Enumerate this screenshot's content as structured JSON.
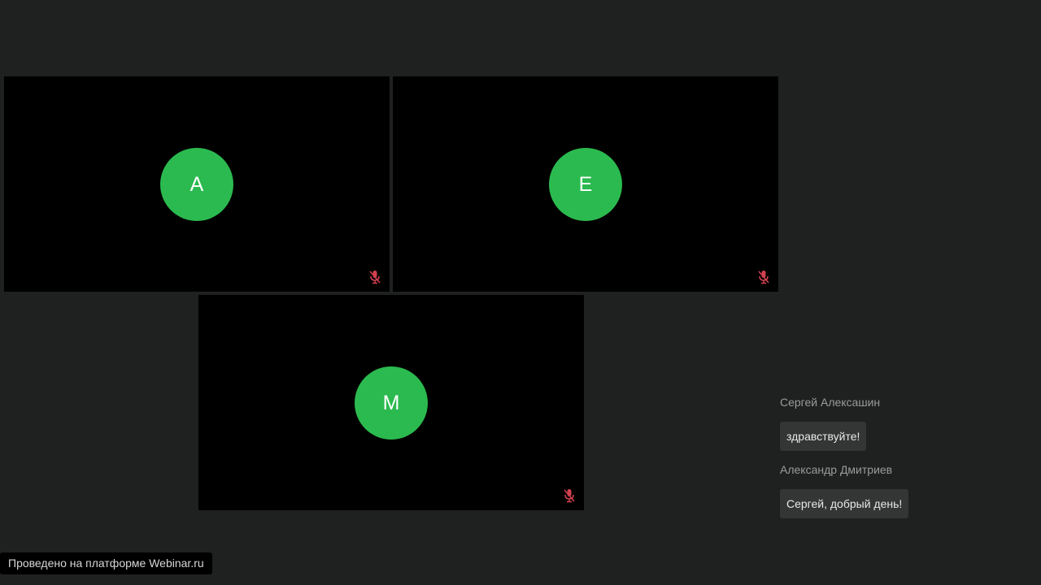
{
  "participants": [
    {
      "initial": "А",
      "mic": "muted-mic-icon"
    },
    {
      "initial": "Е",
      "mic": "muted-mic-icon"
    },
    {
      "initial": "М",
      "mic": "muted-mic-icon"
    }
  ],
  "chat": {
    "messages": [
      {
        "author": "Сергей Алексашин",
        "text": "здравствуйте!"
      },
      {
        "author": "Александр Дмитриев",
        "text": "Сергей, добрый день!"
      }
    ]
  },
  "footer": {
    "platform_text": "Проведено на платформе Webinar.ru"
  },
  "colors": {
    "background": "#1f2020",
    "tile": "#000000",
    "avatar": "#2bba4f",
    "muted_icon": "#d2414f",
    "bubble": "#343535"
  }
}
